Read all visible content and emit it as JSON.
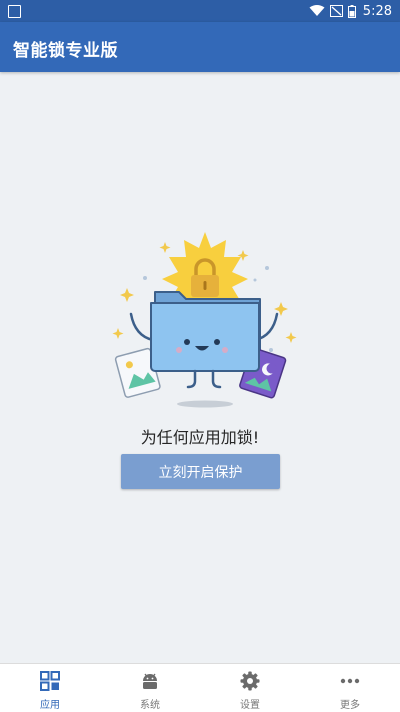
{
  "status_bar": {
    "time": "5:28",
    "left_icon": "app-notification-icon",
    "icons": [
      "wifi-icon",
      "signal-off-icon",
      "battery-icon"
    ]
  },
  "app_bar": {
    "title": "智能锁专业版"
  },
  "empty_state": {
    "illustration": "folder-lock-illustration",
    "message": "为任何应用加锁!",
    "button_label": "立刻开启保护"
  },
  "bottom_nav": {
    "items": [
      {
        "label": "应用",
        "icon": "apps-grid-icon",
        "active": true
      },
      {
        "label": "系统",
        "icon": "android-icon",
        "active": false
      },
      {
        "label": "设置",
        "icon": "gear-icon",
        "active": false
      },
      {
        "label": "更多",
        "icon": "more-dots-icon",
        "active": false
      }
    ]
  },
  "colors": {
    "status_bar": "#2d5ea6",
    "app_bar": "#3369b8",
    "background": "#eef1f4",
    "button": "#7a9ed0",
    "nav_active": "#3369b8",
    "nav_inactive": "#777777"
  }
}
